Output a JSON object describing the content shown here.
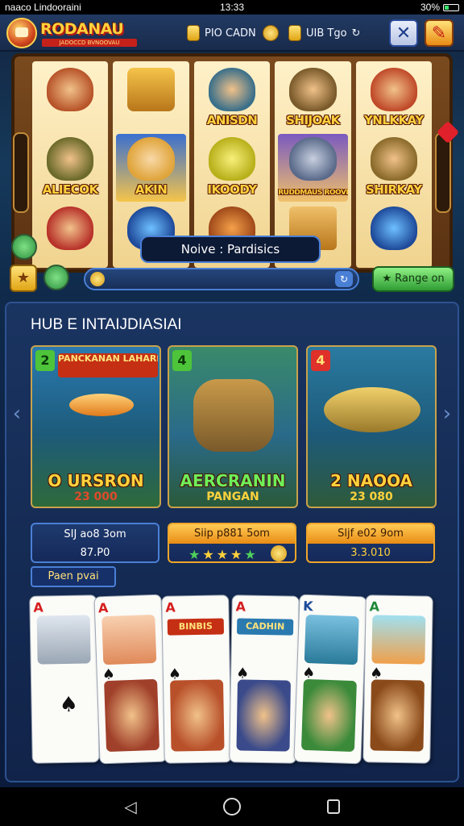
{
  "status_bar": {
    "carrier": "naaco Lindooraini",
    "time": "13:33",
    "battery": "30%"
  },
  "header": {
    "logo_title": "RODANAU",
    "logo_subtitle": "JADOCCD BVNOOVAU",
    "currency_1": "PIO CADN",
    "currency_2": "UIB Tgo",
    "close_icon": "close-icon",
    "promo_icon": "promo-icon"
  },
  "slot": {
    "reels": [
      {
        "cells": [
          {
            "label": ""
          },
          {
            "label": "ALIECOK"
          },
          {
            "label": ""
          }
        ]
      },
      {
        "cells": [
          {
            "label": ""
          },
          {
            "label": "AKIN"
          },
          {
            "label": ""
          }
        ]
      },
      {
        "cells": [
          {
            "label": "ANISDN"
          },
          {
            "label": "IKOODY"
          },
          {
            "label": ""
          }
        ]
      },
      {
        "cells": [
          {
            "label": "SHIJOAK"
          },
          {
            "label": "RUDDMAUS ROOVDSN"
          },
          {
            "label": ""
          }
        ]
      },
      {
        "cells": [
          {
            "label": "YNLKKAY"
          },
          {
            "label": "SHIRKAY"
          },
          {
            "label": ""
          }
        ]
      }
    ],
    "banner": "Noive : Pardisics",
    "range_label": "Range on"
  },
  "hub": {
    "title": "HUB E INTAIJDIASIAI",
    "games": [
      {
        "number": "2",
        "top_name": "PANCKANAN LAHARDSRDIS",
        "name": "O URSRON",
        "value": "23 000"
      },
      {
        "number": "4",
        "top_name": "",
        "name": "AERCRANIN",
        "value": "PANGAN"
      },
      {
        "number": "4",
        "top_name": "",
        "name": "2 NAOOA",
        "value": "23 080"
      }
    ],
    "stats": [
      {
        "title": "SIJ ao8 3om",
        "value": "87.P0"
      },
      {
        "title": "Siip p881 5om",
        "value": ""
      },
      {
        "title": "Sljf e02 9om",
        "value": "3.3.010"
      }
    ],
    "pill": "Paen pvai",
    "cards": [
      {
        "rank": "A",
        "suit": "♠"
      },
      {
        "rank": "A",
        "suit": "♠"
      },
      {
        "rank": "A",
        "suit": "♠",
        "banner": "BINBIS"
      },
      {
        "rank": "A",
        "suit": "♠",
        "banner": "CADHIN"
      },
      {
        "rank": "K",
        "suit": "♠"
      },
      {
        "rank": "A",
        "suit": "♠"
      }
    ]
  },
  "colors": {
    "accent_gold": "#ffd23c",
    "accent_blue": "#4a7fd6",
    "accent_green": "#2e9c34",
    "brand_red": "#c52f14"
  }
}
